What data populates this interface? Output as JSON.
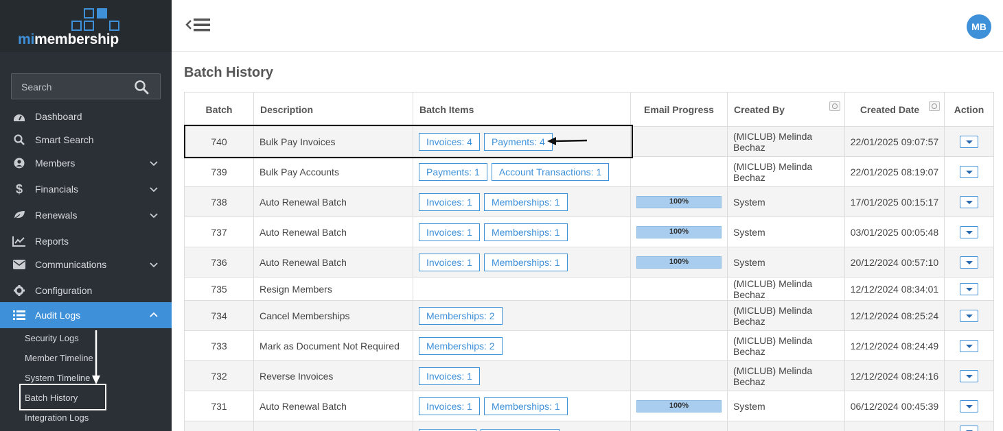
{
  "app": {
    "logo_prefix": "mi",
    "logo_suffix": "membership",
    "brand_color": "#3e90d9"
  },
  "search": {
    "placeholder": "Search"
  },
  "sidebar": {
    "items": [
      {
        "label": "Dashboard",
        "icon": "dashboard-icon"
      },
      {
        "label": "Smart Search",
        "icon": "search-icon"
      },
      {
        "label": "Members",
        "icon": "user-icon",
        "expandable": true
      },
      {
        "label": "Financials",
        "icon": "dollar-icon",
        "expandable": true
      },
      {
        "label": "Renewals",
        "icon": "leaf-icon",
        "expandable": true
      },
      {
        "label": "Reports",
        "icon": "chart-icon"
      },
      {
        "label": "Communications",
        "icon": "envelope-icon",
        "expandable": true
      },
      {
        "label": "Configuration",
        "icon": "gear-icon"
      },
      {
        "label": "Audit Logs",
        "icon": "list-icon",
        "expandable": true,
        "active": true
      }
    ],
    "sub_items": [
      {
        "label": "Security Logs"
      },
      {
        "label": "Member Timeline"
      },
      {
        "label": "System Timeline"
      },
      {
        "label": "Batch History",
        "highlighted": true
      },
      {
        "label": "Integration Logs"
      }
    ]
  },
  "header": {
    "avatar_initials": "MB"
  },
  "page": {
    "title": "Batch History"
  },
  "table": {
    "columns": [
      "Batch",
      "Description",
      "Batch Items",
      "Email Progress",
      "Created By",
      "Created Date",
      "Action"
    ],
    "rows": [
      {
        "batch": "740",
        "description": "Bulk Pay Invoices",
        "items": [
          "Invoices: 4",
          "Payments: 4"
        ],
        "progress": "",
        "created_by": "(MICLUB) Melinda Bechaz",
        "created_date": "22/01/2025 09:07:57"
      },
      {
        "batch": "739",
        "description": "Bulk Pay Accounts",
        "items": [
          "Payments: 1",
          "Account Transactions: 1"
        ],
        "progress": "",
        "created_by": "(MICLUB) Melinda Bechaz",
        "created_date": "22/01/2025 08:19:07"
      },
      {
        "batch": "738",
        "description": "Auto Renewal Batch",
        "items": [
          "Invoices: 1",
          "Memberships: 1"
        ],
        "progress": "100%",
        "created_by": "System",
        "created_date": "17/01/2025 00:15:17"
      },
      {
        "batch": "737",
        "description": "Auto Renewal Batch",
        "items": [
          "Invoices: 1",
          "Memberships: 1"
        ],
        "progress": "100%",
        "created_by": "System",
        "created_date": "03/01/2025 00:05:48"
      },
      {
        "batch": "736",
        "description": "Auto Renewal Batch",
        "items": [
          "Invoices: 1",
          "Memberships: 1"
        ],
        "progress": "100%",
        "created_by": "System",
        "created_date": "20/12/2024 00:57:10"
      },
      {
        "batch": "735",
        "description": "Resign Members",
        "items": [],
        "progress": "",
        "created_by": "(MICLUB) Melinda Bechaz",
        "created_date": "12/12/2024 08:34:01"
      },
      {
        "batch": "734",
        "description": "Cancel Memberships",
        "items": [
          "Memberships: 2"
        ],
        "progress": "",
        "created_by": "(MICLUB) Melinda Bechaz",
        "created_date": "12/12/2024 08:25:24"
      },
      {
        "batch": "733",
        "description": "Mark as Document Not Required",
        "items": [
          "Memberships: 2"
        ],
        "progress": "",
        "created_by": "(MICLUB) Melinda Bechaz",
        "created_date": "12/12/2024 08:24:49"
      },
      {
        "batch": "732",
        "description": "Reverse Invoices",
        "items": [
          "Invoices: 1"
        ],
        "progress": "",
        "created_by": "(MICLUB) Melinda Bechaz",
        "created_date": "12/12/2024 08:24:16"
      },
      {
        "batch": "731",
        "description": "Auto Renewal Batch",
        "items": [
          "Invoices: 1",
          "Memberships: 1"
        ],
        "progress": "100%",
        "created_by": "System",
        "created_date": "06/12/2024 00:45:39"
      },
      {
        "batch": "",
        "description": "",
        "items": [
          "",
          ""
        ],
        "progress": "",
        "created_by": "",
        "created_date": ""
      }
    ]
  }
}
